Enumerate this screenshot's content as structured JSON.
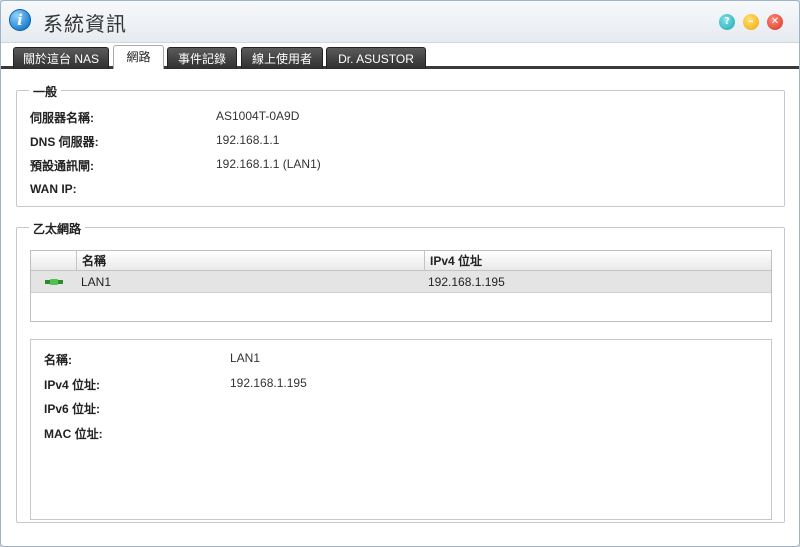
{
  "window": {
    "title": "系統資訊"
  },
  "window_controls": {
    "help": "?",
    "minimize": "–",
    "close": "✕"
  },
  "tabs": [
    {
      "label": "關於這台 NAS"
    },
    {
      "label": "網路"
    },
    {
      "label": "事件記錄"
    },
    {
      "label": "線上使用者"
    },
    {
      "label": "Dr. ASUSTOR"
    }
  ],
  "general": {
    "legend": "一般",
    "rows": [
      {
        "label": "伺服器名稱:",
        "value": "AS1004T-0A9D"
      },
      {
        "label": "DNS 伺服器:",
        "value": "192.168.1.1"
      },
      {
        "label": "預設通訊閘:",
        "value": "192.168.1.1 (LAN1)"
      },
      {
        "label": "WAN IP:",
        "value": ""
      }
    ]
  },
  "ethernet": {
    "legend": "乙太網路",
    "columns": [
      "名稱",
      "IPv4 位址"
    ],
    "rows": [
      {
        "name": "LAN1",
        "ipv4": "192.168.1.195"
      }
    ],
    "detail": [
      {
        "label": "名稱:",
        "value": "LAN1"
      },
      {
        "label": "IPv4 位址:",
        "value": "192.168.1.195"
      },
      {
        "label": "IPv6 位址:",
        "value": ""
      },
      {
        "label": "MAC 位址:",
        "value": ""
      }
    ]
  },
  "colors": {
    "accent": "#1e7fd0",
    "tab_dark": "#3a3a3a",
    "link_icon": "#3aa53a"
  }
}
